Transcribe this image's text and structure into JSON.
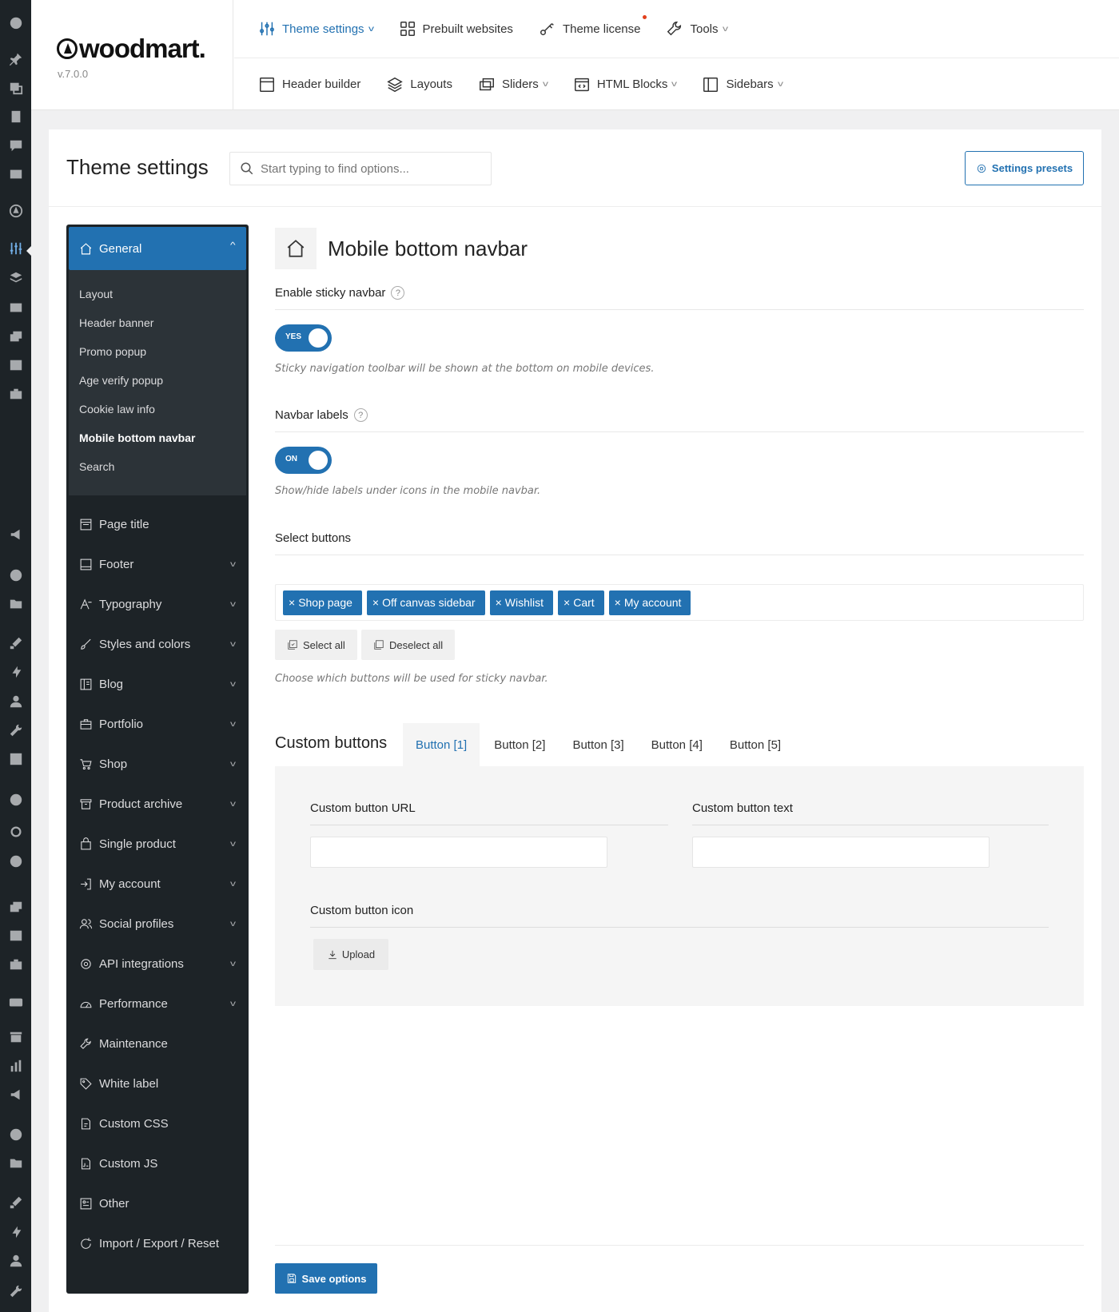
{
  "brand": {
    "name": "woodmart.",
    "version": "v.7.0.0"
  },
  "topnav": {
    "row1": [
      {
        "label": "Theme settings",
        "icon": "sliders-icon",
        "active": true,
        "has_dropdown": true
      },
      {
        "label": "Prebuilt websites",
        "icon": "grid-icon"
      },
      {
        "label": "Theme license",
        "icon": "key-icon",
        "notification_dot": true
      },
      {
        "label": "Tools",
        "icon": "wrench-icon",
        "has_dropdown": true
      }
    ],
    "row2": [
      {
        "label": "Header builder",
        "icon": "layout-icon"
      },
      {
        "label": "Layouts",
        "icon": "layers-icon"
      },
      {
        "label": "Sliders",
        "icon": "slides-icon",
        "has_dropdown": true
      },
      {
        "label": "HTML Blocks",
        "icon": "code-block-icon",
        "has_dropdown": true
      },
      {
        "label": "Sidebars",
        "icon": "sidebar-icon",
        "has_dropdown": true
      }
    ]
  },
  "header": {
    "title": "Theme settings",
    "search_placeholder": "Start typing to find options...",
    "presets_label": "Settings presets"
  },
  "sidebar": {
    "general_label": "General",
    "general_sub": [
      "Layout",
      "Header banner",
      "Promo popup",
      "Age verify popup",
      "Cookie law info",
      "Mobile bottom navbar",
      "Search"
    ],
    "current_sub": "Mobile bottom navbar",
    "items": [
      {
        "label": "Page title",
        "icon": "page-title-icon"
      },
      {
        "label": "Footer",
        "icon": "footer-icon",
        "dropdown": true
      },
      {
        "label": "Typography",
        "icon": "typography-icon",
        "dropdown": true
      },
      {
        "label": "Styles and colors",
        "icon": "brush-icon",
        "dropdown": true
      },
      {
        "label": "Blog",
        "icon": "blog-icon",
        "dropdown": true
      },
      {
        "label": "Portfolio",
        "icon": "briefcase-icon",
        "dropdown": true
      },
      {
        "label": "Shop",
        "icon": "cart-icon",
        "dropdown": true
      },
      {
        "label": "Product archive",
        "icon": "archive-icon",
        "dropdown": true
      },
      {
        "label": "Single product",
        "icon": "bag-icon",
        "dropdown": true
      },
      {
        "label": "My account",
        "icon": "login-icon",
        "dropdown": true
      },
      {
        "label": "Social profiles",
        "icon": "users-icon",
        "dropdown": true
      },
      {
        "label": "API integrations",
        "icon": "gear-icon",
        "dropdown": true
      },
      {
        "label": "Performance",
        "icon": "gauge-icon",
        "dropdown": true
      },
      {
        "label": "Maintenance",
        "icon": "wrench-icon"
      },
      {
        "label": "White label",
        "icon": "tag-icon"
      },
      {
        "label": "Custom CSS",
        "icon": "css-file-icon"
      },
      {
        "label": "Custom JS",
        "icon": "js-file-icon"
      },
      {
        "label": "Other",
        "icon": "other-icon"
      },
      {
        "label": "Import / Export / Reset",
        "icon": "refresh-icon"
      }
    ]
  },
  "section": {
    "title": "Mobile bottom navbar",
    "icon": "home-icon",
    "sticky": {
      "label": "Enable sticky navbar",
      "toggle": "YES",
      "desc": "Sticky navigation toolbar will be shown at the bottom on mobile devices."
    },
    "labels": {
      "label": "Navbar labels",
      "toggle": "ON",
      "desc": "Show/hide labels under icons in the mobile navbar."
    },
    "buttons": {
      "label": "Select buttons",
      "chips": [
        "Shop page",
        "Off canvas sidebar",
        "Wishlist",
        "Cart",
        "My account"
      ],
      "select_all": "Select all",
      "deselect_all": "Deselect all",
      "desc": "Choose which buttons will be used for sticky navbar."
    },
    "custom": {
      "title": "Custom buttons",
      "tabs": [
        "Button [1]",
        "Button [2]",
        "Button [3]",
        "Button [4]",
        "Button [5]"
      ],
      "active_tab": "Button [1]",
      "url_label": "Custom button URL",
      "url_value": "",
      "text_label": "Custom button text",
      "text_value": "",
      "icon_label": "Custom button icon",
      "upload_label": "Upload"
    },
    "save_label": "Save options"
  },
  "colors": {
    "accent": "#2271b1",
    "wp_sidebar": "#1d2327"
  }
}
